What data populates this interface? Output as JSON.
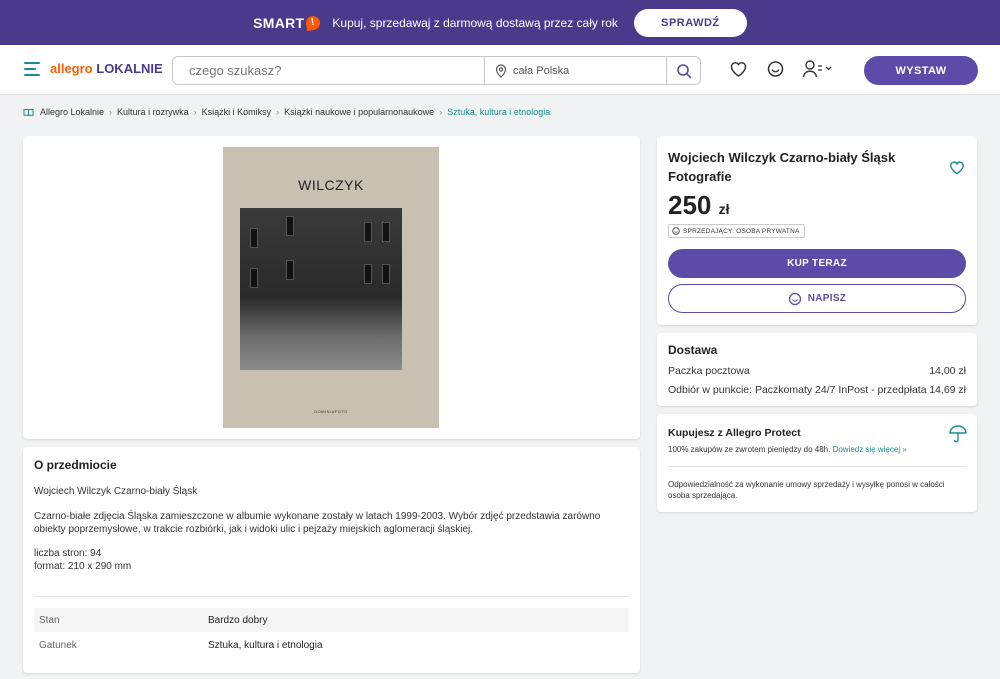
{
  "promo": {
    "brand": "SMART",
    "brand_mark": "!",
    "text": "Kupuj, sprzedawaj z darmową dostawą przez cały rok",
    "button": "SPRAWDŹ"
  },
  "header": {
    "logo_part1": "allegro",
    "logo_part2": "LOKALNIE",
    "search_placeholder": "czego szukasz?",
    "location": "cała Polska",
    "sell_button": "WYSTAW"
  },
  "breadcrumb": [
    "Allegro Lokalnie",
    "Kultura i rozrywka",
    "Książki i Komiksy",
    "Książki naukowe i popularnonaukowe",
    "Sztuka, kultura i etnologia"
  ],
  "product_image": {
    "cover_title": "WILCZYK",
    "cover_publisher": "DOMINIAFOTO"
  },
  "description": {
    "heading": "O przedmiocie",
    "line1": "Wojciech Wilczyk Czarno-biały Śląsk",
    "line2": "Czarno-białe zdjęcia Śląska zamieszczone w albumie wykonane zostały w latach 1999-2003. Wybór zdjęć przedstawia zarówno obiekty poprzemysłowe, w trakcie rozbiórki, jak i widoki ulic i pejzaży miejskich aglomeracji śląskiej.",
    "line3": "liczba stron: 94",
    "line4": "format: 210 x 290 mm",
    "params": [
      {
        "key": "Stan",
        "value": "Bardzo dobry"
      },
      {
        "key": "Gatunek",
        "value": "Sztuka, kultura i etnologia"
      }
    ]
  },
  "offer": {
    "title": "Wojciech Wilczyk Czarno-biały Śląsk Fotografie",
    "price": "250",
    "currency": "zł",
    "seller_badge": "SPRZEDAJĄCY: OSOBA PRYWATNA",
    "buy_button": "KUP TERAZ",
    "message_button": "NAPISZ"
  },
  "delivery": {
    "heading": "Dostawa",
    "options": [
      {
        "name": "Paczka pocztowa",
        "price": "14,00 zł"
      },
      {
        "name": "Odbiór w punkcie: Paczkomaty 24/7 InPost - przedpłata",
        "price": "14,69 zł"
      }
    ]
  },
  "protect": {
    "heading": "Kupujesz z Allegro Protect",
    "text": "100% zakupów ze zwrotem pieniędzy do 48h.",
    "link": "Dowiedz się więcej »",
    "note": "Odpowiedzialność za wykonanie umowy sprzedaży i wysyłkę ponosi w całości osoba sprzedająca."
  },
  "colors": {
    "primary": "#5c4ba8",
    "promo_bg": "#4a3a8c",
    "accent_teal": "#1b8c8c",
    "brand_orange": "#ff5a00"
  }
}
